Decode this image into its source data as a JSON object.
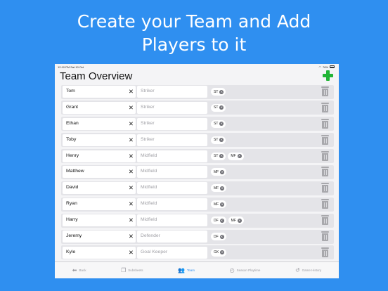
{
  "headline": {
    "line1": "Create your Team and Add",
    "line2": "Players to it"
  },
  "status_bar": {
    "time_date": "12:10 PM  Sat 10 Oct",
    "battery": "76%"
  },
  "header": {
    "title": "Team Overview"
  },
  "players": [
    {
      "name": "Tom",
      "position": "Striker",
      "chips": [
        "ST"
      ]
    },
    {
      "name": "Grant",
      "position": "Striker",
      "chips": [
        "ST"
      ]
    },
    {
      "name": "Ethan",
      "position": "Striker",
      "chips": [
        "ST"
      ]
    },
    {
      "name": "Toby",
      "position": "Striker",
      "chips": [
        "ST"
      ]
    },
    {
      "name": "Henry",
      "position": "Midfield",
      "chips": [
        "ST",
        "MF"
      ]
    },
    {
      "name": "Matthew",
      "position": "Midfield",
      "chips": [
        "MF"
      ]
    },
    {
      "name": "David",
      "position": "Midfield",
      "chips": [
        "MF"
      ]
    },
    {
      "name": "Ryan",
      "position": "Midfield",
      "chips": [
        "MF"
      ]
    },
    {
      "name": "Harry",
      "position": "Midfield",
      "chips": [
        "DF",
        "MF"
      ]
    },
    {
      "name": "Jeremy",
      "position": "Defender",
      "chips": [
        "DF"
      ]
    },
    {
      "name": "Kyle",
      "position": "Goal Keeper",
      "chips": [
        "GK"
      ]
    }
  ],
  "tabbar": {
    "items": [
      {
        "label": "Back",
        "icon": "arrow-left-icon"
      },
      {
        "label": "Subsheets",
        "icon": "sheets-icon"
      },
      {
        "label": "Team",
        "icon": "team-icon"
      },
      {
        "label": "Season Playtime",
        "icon": "stopwatch-icon"
      },
      {
        "label": "Game History",
        "icon": "history-icon"
      }
    ]
  },
  "colors": {
    "background": "#2f8ff0",
    "add": "#21b436",
    "active_tab": "#2f8ff0"
  }
}
